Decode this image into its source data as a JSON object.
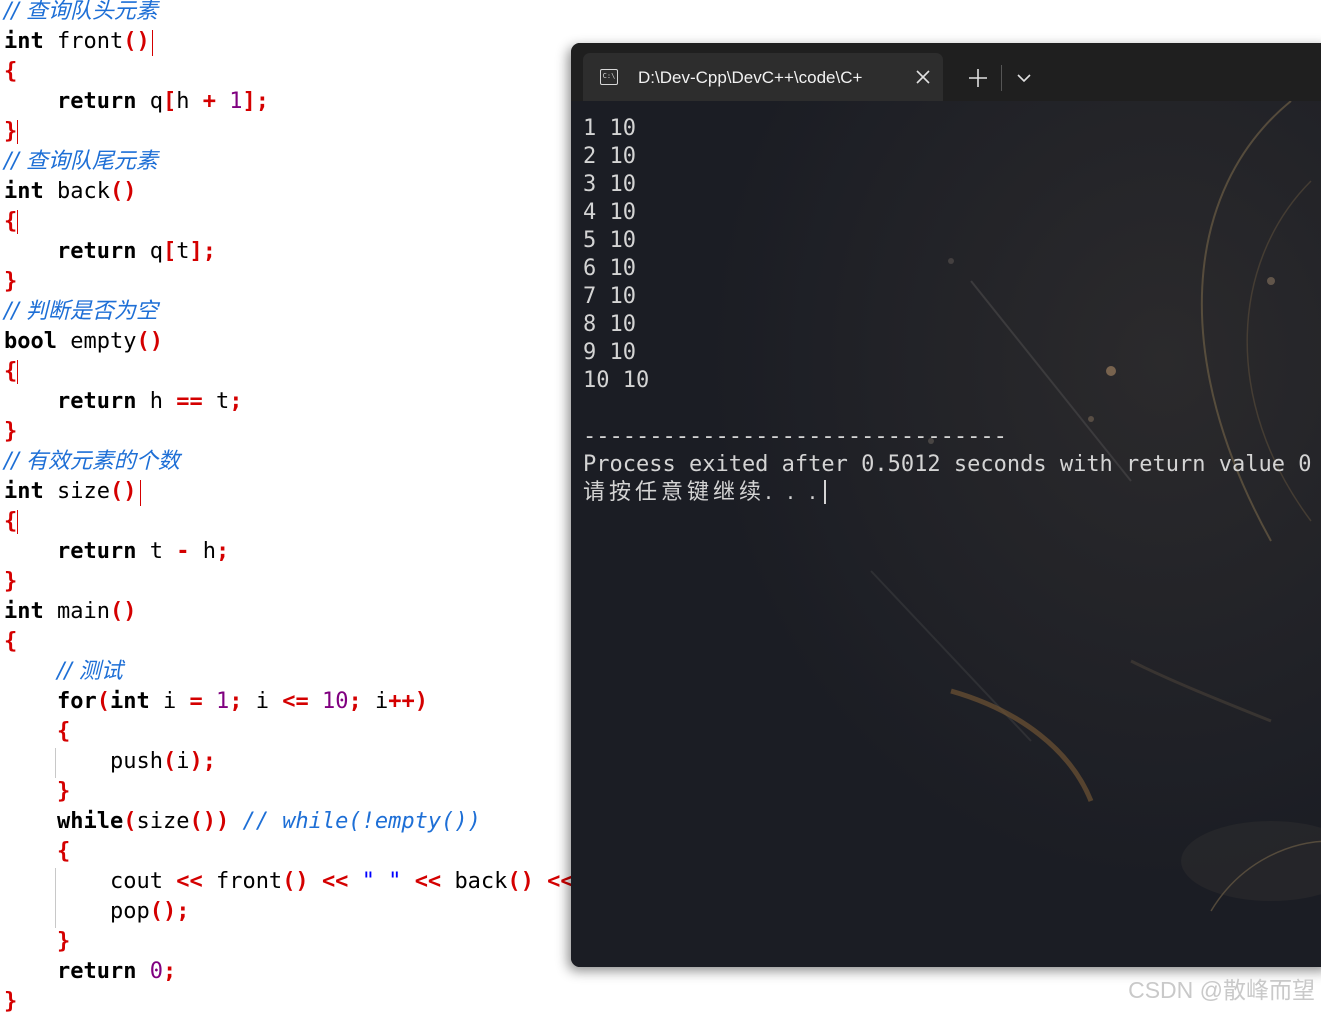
{
  "editor": {
    "comment_front": "// 查询队头元素",
    "comment_back": "// 查询队尾元素",
    "comment_empty": "// 判断是否为空",
    "comment_size": "// 有效元素的个数",
    "comment_test": "// 测试",
    "comment_while": "// while(!empty())",
    "kw_int": "int",
    "kw_bool": "bool",
    "kw_return": "return",
    "kw_for": "for",
    "kw_while": "while",
    "fn_front": "front",
    "fn_back": "back",
    "fn_empty": "empty",
    "fn_size": "size",
    "fn_main": "main",
    "fn_push": "push",
    "fn_pop": "pop",
    "id_q": "q",
    "id_h": "h",
    "id_t": "t",
    "id_i": "i",
    "id_cout": "cout",
    "num_0": "0",
    "num_1": "1",
    "num_10": "10",
    "str_space": "\" \"",
    "sym_paren": "()",
    "sym_lbrace": "{",
    "sym_rbrace": "}",
    "sym_lbr": "[",
    "sym_rbr": "];",
    "sym_plus": "+",
    "sym_minus": "-",
    "sym_eqeq": "==",
    "sym_eq": "=",
    "sym_le": "<=",
    "sym_inc": "++",
    "sym_shl": "<<",
    "sym_semi": ";",
    "sym_lparen": "(",
    "sym_rparen": ")",
    "sym_rparen2": "))",
    "sym_callsemi": "();",
    "sym_rparsemi": ");"
  },
  "terminal": {
    "tab_title": "D:\\Dev-Cpp\\DevC++\\code\\C+",
    "tab_icon": "cmd-icon",
    "tab_icon_text": "C:\\",
    "output_lines": [
      "1 10",
      "2 10",
      "3 10",
      "4 10",
      "5 10",
      "6 10",
      "7 10",
      "8 10",
      "9 10",
      "10 10"
    ],
    "separator": "--------------------------------",
    "process_line": "Process exited after 0.5012 seconds with return value 0",
    "press_key": "请按任意键继续. . ."
  },
  "watermark": "CSDN @散峰而望",
  "colors": {
    "keyword": "#000000",
    "symbol": "#d40000",
    "number": "#800080",
    "string": "#0000ff",
    "comment": "#1e6fd6",
    "terminal_bg": "#1d1f26",
    "terminal_text": "#d4d4d4"
  }
}
